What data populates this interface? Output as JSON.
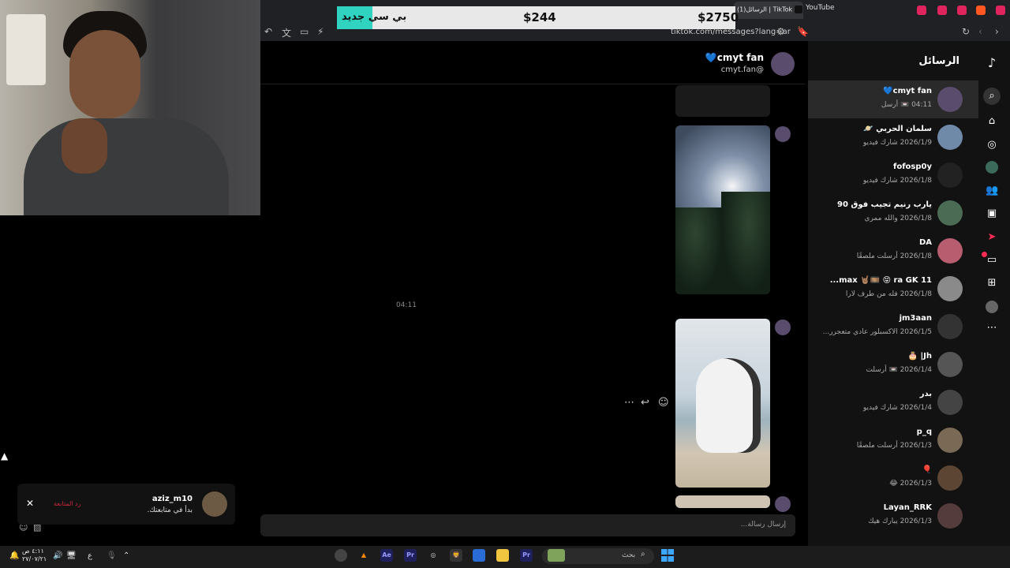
{
  "browser": {
    "tab_youtube": "YouTube",
    "tab_tiktok": "(1)الرسائل | TikTok",
    "url": "tiktok.com/messages?lang=ar"
  },
  "ticker": {
    "headline": "بي سي جديد",
    "price_1": "$244",
    "price_2": "$2750"
  },
  "sidebar": {
    "title": "الرسائل",
    "conversations": [
      {
        "name": "cmyt fan💙",
        "sub": "04:11 📼 أرسل"
      },
      {
        "name": "سلمان الحربي 🪐",
        "sub": "2026/1/9 شارك فيديو"
      },
      {
        "name": "fofosp0y",
        "sub": "2026/1/8 شارك فيديو"
      },
      {
        "name": "يارب رنيم تجيب فوق 90",
        "sub": "2026/1/8 والله ممري"
      },
      {
        "name": "DA",
        "sub": "2026/1/8 أرسلت ملصقًا"
      },
      {
        "name": "max 🤘🏽🎞️ 😝 ra GK 11...",
        "sub": "2026/1/8 فله من طرف لارا"
      },
      {
        "name": "jm3aan",
        "sub": "2026/1/5 الاكسبلور عادي متعجرر..."
      },
      {
        "name": "Jh| 🎂",
        "sub": "2026/1/4 📼 أرسلت"
      },
      {
        "name": "بدر",
        "sub": "2026/1/4 شارك فيديو"
      },
      {
        "name": "p_q",
        "sub": "2026/1/3 أرسلت ملصقًا"
      },
      {
        "name": "🎈",
        "sub": "2026/1/3 😂"
      },
      {
        "name": "Layan_RRK",
        "sub": "2026/1/3 يبارك هيك"
      }
    ]
  },
  "chat": {
    "name": "cmyt fan💙",
    "handle": "cmyt.fan@",
    "timestamp": "04:11",
    "input_placeholder": "إرسال رسالة..."
  },
  "toast": {
    "user": "aziz_m10",
    "text": "بدأ في متابعتك.",
    "follow_back": "رد المتابعة"
  },
  "taskbar": {
    "time": "٤:١١ ص",
    "date": "٢٧/٠٧/٢١",
    "lang": "ع",
    "search_placeholder": "بحث"
  },
  "colors": {
    "accent_teal": "#2fd3bf",
    "tiktok_red": "#c8283d",
    "sidebar_bg": "#121212"
  }
}
